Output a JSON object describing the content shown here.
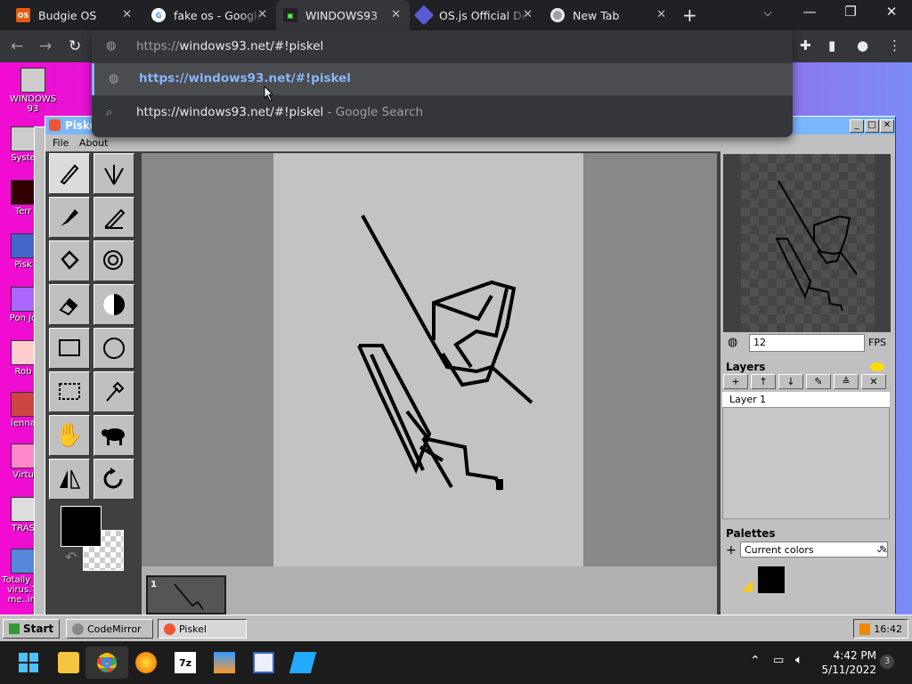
{
  "browser": {
    "tabs": [
      {
        "title": "Budgie OS",
        "favicon": "os-icon"
      },
      {
        "title": "fake os - Google Search",
        "favicon": "google-icon"
      },
      {
        "title": "WINDOWS93",
        "favicon": "win93-icon"
      },
      {
        "title": "OS.js Official Demo",
        "favicon": "osjs-icon"
      },
      {
        "title": "New Tab",
        "favicon": "chrome-icon"
      }
    ],
    "address_value_dim": "https://",
    "address_value": "windows93.net/#!piskel",
    "suggestions": [
      {
        "text": "https://windows93.net/#!piskel",
        "suffix": ""
      },
      {
        "text": "https://windows93.net/#!piskel",
        "suffix": " - Google Search"
      }
    ]
  },
  "desktop": {
    "icons": [
      "WINDOWS 93",
      "Syste",
      "Terr",
      "Pisk",
      "Pon Jo",
      "Rob",
      "lenna",
      "Virtu",
      "TRAS",
      "Totally no virus.Tr me..im"
    ]
  },
  "piskel": {
    "title": "Piskel",
    "menu": [
      "File",
      "About"
    ],
    "fps_value": "12",
    "fps_label": "FPS",
    "layers_title": "Layers",
    "layer_name": "Layer 1",
    "palettes_title": "Palettes",
    "palette_selected": "Current colors",
    "frame_number": "1"
  },
  "taskbar93": {
    "start": "Start",
    "items": [
      "CodeMirror",
      "Piskel"
    ],
    "clock": "16:42"
  },
  "windows_taskbar": {
    "time": "4:42 PM",
    "date": "5/11/2022",
    "notification_count": "3"
  },
  "colors": {
    "chrome_bg": "#202124",
    "active_tab": "#35363a",
    "link": "#8ab4f8",
    "win93_gray": "#c0c0c0"
  }
}
